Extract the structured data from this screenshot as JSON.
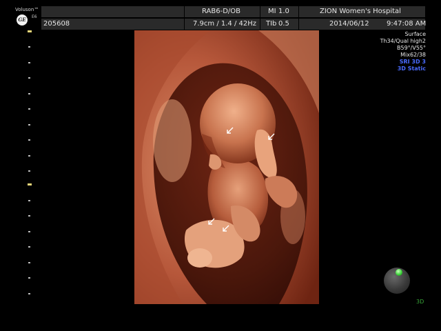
{
  "header": {
    "brand": "Voluson™",
    "model": "E6",
    "logo_text": "GE",
    "patient_id": "205608",
    "probe": "RAB6-D/OB",
    "acq_params": "7.9cm / 1.4 / 42Hz",
    "mi_label": "MI",
    "mi_value": "1.0",
    "tib_label": "TIb",
    "tib_value": "0.5",
    "hospital": "ZION Women's Hospital",
    "date": "2014/06/12",
    "time": "9:47:08 AM"
  },
  "render_info": {
    "mode": "Surface",
    "threshold_quality": "Th34/Qual high2",
    "angles": "B59°/V55°",
    "mix": "Mix62/38",
    "sri": "SRI 3D 3",
    "static": "3D Static"
  },
  "orientation": {
    "label": "3D"
  },
  "colors": {
    "header_bar": "#2a2a2a",
    "accent_blue": "#4a6bff",
    "scale_marker": "#e8d77a",
    "orientation_green": "#3cd43a",
    "tissue": "#c0694a"
  },
  "icons": {
    "logo": "ge-logo-icon",
    "orientation": "orientation-sphere-icon",
    "markers": "arrow-marker-icon"
  }
}
